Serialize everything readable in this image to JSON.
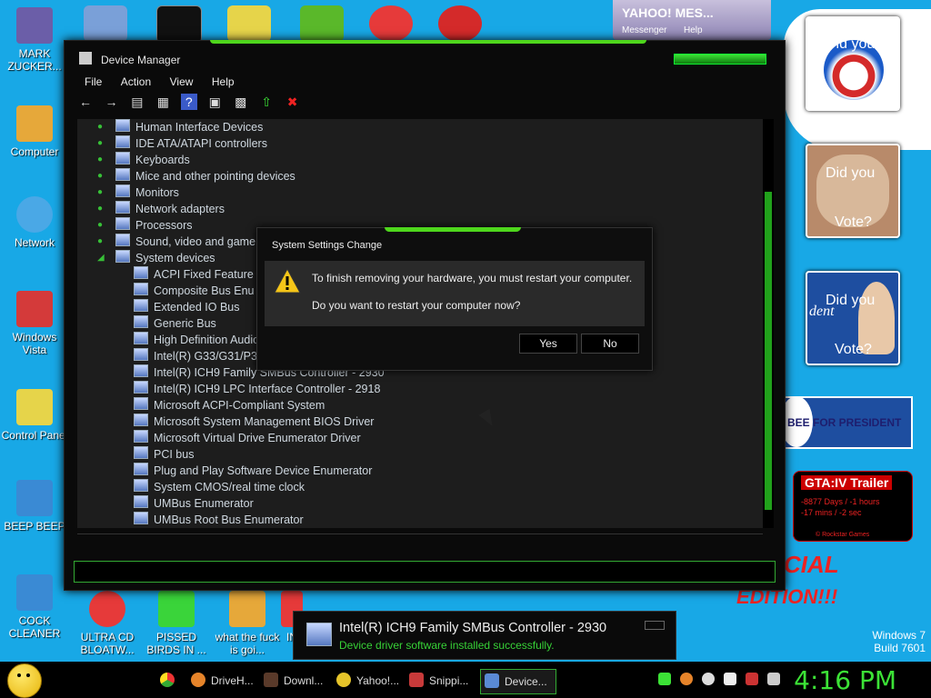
{
  "desktop": {
    "icons": [
      {
        "label": "MARK ZUCKER...",
        "color": "#6b5ea8"
      },
      {
        "label": "Computer",
        "color": "#e6a83a"
      },
      {
        "label": "Network",
        "color": "#4aa8e6"
      },
      {
        "label": "Windows Vista",
        "color": "#d43a3a"
      },
      {
        "label": "Control Panel",
        "color": "#e6d44a"
      },
      {
        "label": "BEEP BEEP",
        "color": "#3a8ad4"
      },
      {
        "label": "COCK CLEANER",
        "color": "#3a8ad4"
      }
    ],
    "bottom_icons": [
      {
        "label": "ULTRA CD BLOATW...",
        "color": "#e63a3a"
      },
      {
        "label": "PISSED BIRDS IN ...",
        "color": "#3ad43a"
      },
      {
        "label": "what the fuck is goi...",
        "color": "#e6a83a"
      },
      {
        "label": "IN",
        "color": "#e6a83a"
      }
    ],
    "watermark_line1": "Windows 7",
    "watermark_line2": "Build 7601"
  },
  "gadgets": {
    "yahoo_title": "YAHOO! MES...",
    "yahoo_sub1": "Messenger",
    "yahoo_sub2": "Help",
    "vote1": "Did you",
    "vote2_a": "Did you",
    "vote2_b": "Vote?",
    "vote3_a": "Did you",
    "vote3_b": "Vote?",
    "vote3_c": "dent",
    "huckabee": "BEE FOR PRESIDENT",
    "gta_title": "GTA:IV Trailer",
    "gta_line1": "-8877 Days / -1 hours",
    "gta_line2": "-17 mins / -2 sec",
    "gta_line3": "© Rockstar Games",
    "edition1": "CIAL",
    "edition2": "EDITION!!!"
  },
  "device_manager": {
    "title": "Device Manager",
    "menu": [
      "File",
      "Action",
      "View",
      "Help"
    ],
    "categories": [
      "Human Interface Devices",
      "IDE ATA/ATAPI controllers",
      "Keyboards",
      "Mice and other pointing devices",
      "Monitors",
      "Network adapters",
      "Processors",
      "Sound, video and game",
      "System devices"
    ],
    "system_devices": [
      "ACPI Fixed Feature",
      "Composite Bus Enu",
      "Extended IO Bus",
      "Generic Bus",
      "High Definition Audio",
      "Intel(R) G33/G31/P3",
      "Intel(R) ICH9 Family SMBus Controller - 2930",
      "Intel(R) ICH9 LPC Interface Controller - 2918",
      "Microsoft ACPI-Compliant System",
      "Microsoft System Management BIOS Driver",
      "Microsoft Virtual Drive Enumerator Driver",
      "PCI bus",
      "Plug and Play Software Device Enumerator",
      "System CMOS/real time clock",
      "UMBus Enumerator",
      "UMBus Root Bus Enumerator"
    ]
  },
  "dialog": {
    "title": "System Settings Change",
    "message1": "To finish removing your hardware, you must restart your computer.",
    "message2": "Do you want to restart your computer now?",
    "yes": "Yes",
    "no": "No"
  },
  "balloon": {
    "title": "Intel(R) ICH9 Family SMBus Controller - 2930",
    "text": "Device driver software installed successfully."
  },
  "taskbar": {
    "buttons": [
      {
        "label": "DriveH...",
        "color": "#e6842a"
      },
      {
        "label": "Downl...",
        "color": "#5a3a2a"
      },
      {
        "label": "Yahoo!...",
        "color": "#e6c42a"
      },
      {
        "label": "Snippi...",
        "color": "#c83a3a"
      },
      {
        "label": "Device...",
        "color": "#5a8ad4"
      }
    ],
    "clock": "4:16 PM"
  }
}
